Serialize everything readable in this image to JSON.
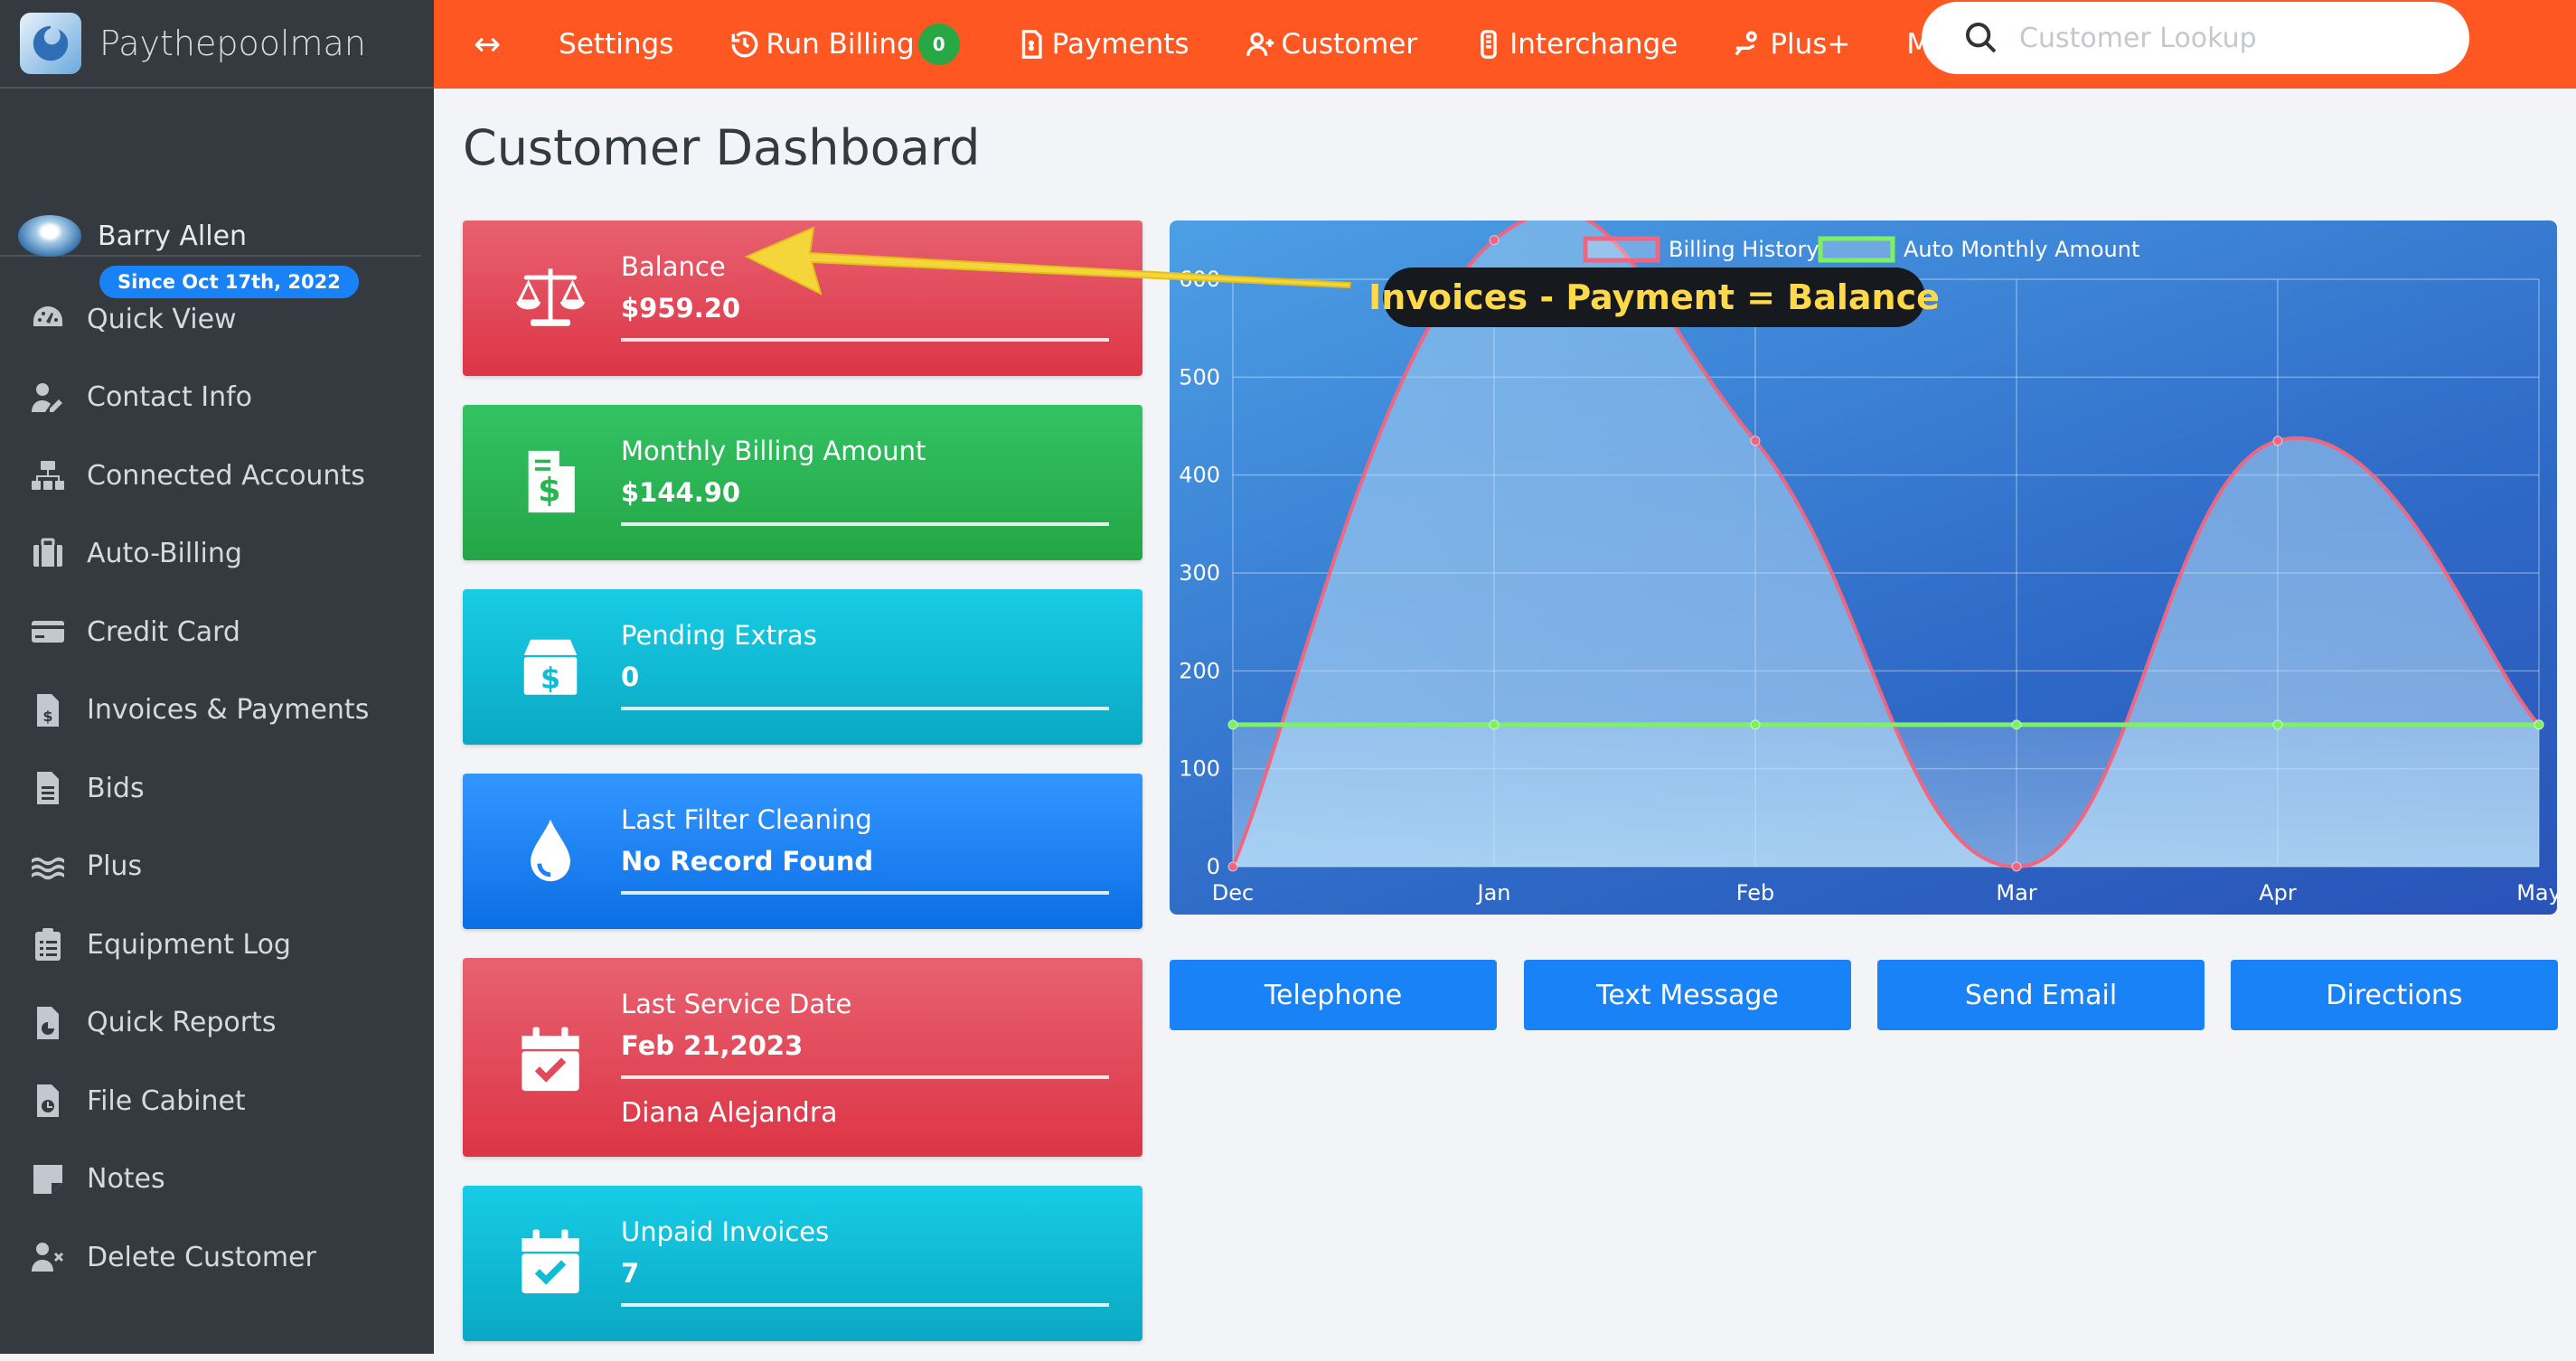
{
  "brand": {
    "name": "Paythepoolman"
  },
  "user": {
    "name": "Barry Allen",
    "since": "Since Oct 17th, 2022"
  },
  "sidebar": {
    "items": [
      {
        "label": "Quick View",
        "icon": "gauge-icon"
      },
      {
        "label": "Contact Info",
        "icon": "user-edit-icon"
      },
      {
        "label": "Connected Accounts",
        "icon": "network-icon"
      },
      {
        "label": "Auto-Billing",
        "icon": "briefcase-icon"
      },
      {
        "label": "Credit Card",
        "icon": "credit-card-icon"
      },
      {
        "label": "Invoices & Payments",
        "icon": "invoice-dollar-icon"
      },
      {
        "label": "Bids",
        "icon": "document-icon"
      },
      {
        "label": "Plus",
        "icon": "water-icon"
      },
      {
        "label": "Equipment Log",
        "icon": "clipboard-list-icon"
      },
      {
        "label": "Quick Reports",
        "icon": "file-chart-icon"
      },
      {
        "label": "File Cabinet",
        "icon": "file-clock-icon"
      },
      {
        "label": "Notes",
        "icon": "sticky-note-icon"
      },
      {
        "label": "Delete Customer",
        "icon": "user-times-icon"
      }
    ]
  },
  "topnav": {
    "toggle": "↔",
    "settings": "Settings",
    "run_billing": "Run Billing",
    "run_billing_badge": "0",
    "payments": "Payments",
    "customer": "Customer",
    "interchange": "Interchange",
    "plus": "Plus+",
    "more": "More",
    "search_placeholder": "Customer Lookup"
  },
  "page": {
    "title": "Customer Dashboard"
  },
  "cards": {
    "balance": {
      "label": "Balance",
      "value": "$959.20"
    },
    "monthly": {
      "label": "Monthly Billing Amount",
      "value": "$144.90"
    },
    "pending": {
      "label": "Pending Extras",
      "value": "0"
    },
    "filter": {
      "label": "Last Filter Cleaning",
      "value": "No Record Found"
    },
    "service": {
      "label": "Last Service Date",
      "value": "Feb 21,2023",
      "tech": "Diana Alejandra"
    },
    "unpaid": {
      "label": "Unpaid Invoices",
      "value": "7"
    }
  },
  "annotation": {
    "text": "Invoices - Payment = Balance"
  },
  "colors": {
    "accent": "#ff5722",
    "billing_history": "#f06680",
    "auto_monthly": "#7cf25f",
    "button": "#1a82f7"
  },
  "chart_data": {
    "type": "line",
    "categories": [
      "Dec",
      "Jan",
      "Feb",
      "Mar",
      "Apr",
      "May"
    ],
    "series": [
      {
        "name": "Billing History",
        "values": [
          0,
          640,
          435,
          0,
          435,
          145
        ]
      },
      {
        "name": "Auto Monthly Amount",
        "values": [
          145,
          145,
          145,
          145,
          145,
          145
        ]
      }
    ],
    "ylim": [
      0,
      600
    ],
    "yticks": [
      "0",
      "100",
      "200",
      "300",
      "400",
      "500",
      "600"
    ],
    "legend": "top",
    "grid": true
  },
  "actions": {
    "telephone": "Telephone",
    "text": "Text Message",
    "email": "Send Email",
    "directions": "Directions"
  }
}
